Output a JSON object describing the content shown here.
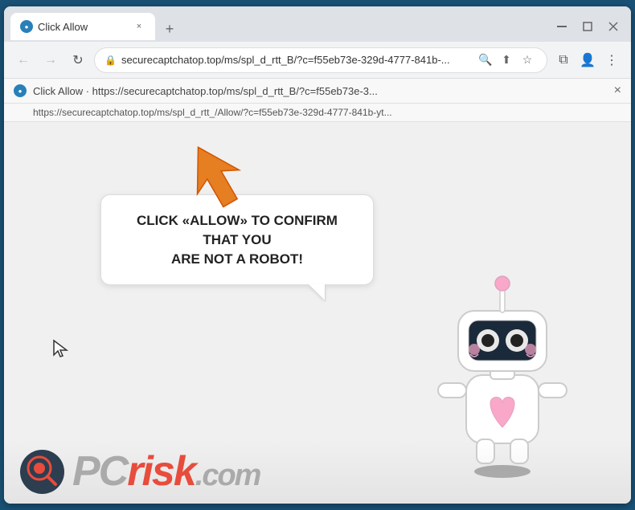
{
  "browser": {
    "tab": {
      "title": "Click Allow",
      "favicon": "●",
      "close_label": "×"
    },
    "new_tab_label": "+",
    "window_controls": {
      "minimize": "─",
      "maximize": "□",
      "close": "✕"
    },
    "nav": {
      "back": "←",
      "forward": "→",
      "refresh": "↻"
    },
    "url": "securecaptchatop.top/ms/spl_d_rtt_B/?c=f55eb73e-329d-4777-841b-...",
    "url_icons": {
      "lock": "🔒",
      "search": "🔍",
      "share": "⬆",
      "star": "☆",
      "split": "⧉",
      "profile": "👤",
      "menu": "⋮"
    }
  },
  "notification": {
    "line1": "Click Allow · https://securecaptchatop.top/ms/spl_d_rtt_B/?c=f55eb73e-3...",
    "line2": "https://securecaptchatop.top/ms/spl_d_rtt_/Allow/?c=f55eb73e-329d-4777-841b-yt...",
    "close": "×"
  },
  "page": {
    "bubble_text_line1": "CLICK «ALLOW» TO CONFIRM THAT YOU",
    "bubble_text_line2": "ARE NOT A ROBOT!"
  },
  "watermark": {
    "logo": "🔍",
    "text_pc": "PC",
    "text_risk": "risk",
    "text_com": ".com"
  }
}
